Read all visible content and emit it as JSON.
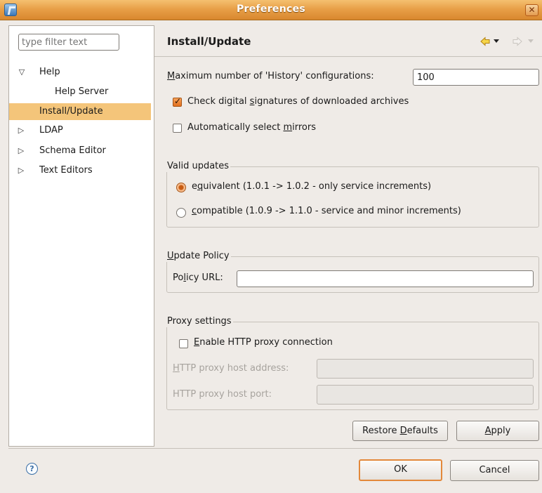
{
  "window": {
    "title": "Preferences",
    "close_glyph": "✕"
  },
  "sidebar": {
    "filter_placeholder": "type filter text",
    "items": [
      {
        "label": "Help",
        "expanded": true
      },
      {
        "label": "Help Server"
      },
      {
        "label": "Install/Update",
        "selected": true
      },
      {
        "label": "LDAP",
        "expanded": false
      },
      {
        "label": "Schema Editor",
        "expanded": false
      },
      {
        "label": "Text Editors",
        "expanded": false
      }
    ]
  },
  "page": {
    "title": "Install/Update",
    "max_history": {
      "label_pre": "M",
      "label_post": "aximum number of 'History' configurations:",
      "value": "100"
    },
    "check_signatures": {
      "pre": "Check digital ",
      "mn": "s",
      "post": "ignatures of downloaded archives",
      "checked": true
    },
    "auto_mirrors": {
      "pre": "Automatically select ",
      "mn": "m",
      "post": "irrors",
      "checked": false
    },
    "valid_updates": {
      "title": "Valid updates",
      "equivalent": {
        "pre": "e",
        "mn": "q",
        "post": "uivalent (1.0.1 -> 1.0.2 - only service increments)",
        "selected": true
      },
      "compatible": {
        "pre": "",
        "mn": "c",
        "post": "ompatible (1.0.9 -> 1.1.0 - service and minor increments)",
        "selected": false
      }
    },
    "update_policy": {
      "title_mn": "U",
      "title_post": "pdate Policy",
      "url_pre": "Po",
      "url_mn": "l",
      "url_post": "icy URL:",
      "url_value": ""
    },
    "proxy": {
      "title": "Proxy settings",
      "enable": {
        "pre": "",
        "mn": "E",
        "post": "nable HTTP proxy connection",
        "checked": false
      },
      "host": {
        "mn": "H",
        "post": "TTP proxy host address:",
        "value": ""
      },
      "port": {
        "label": "HTTP proxy host port:",
        "value": ""
      }
    },
    "restore": {
      "pre": "Restore ",
      "mn": "D",
      "post": "efaults"
    },
    "apply": {
      "mn": "A",
      "post": "pply"
    }
  },
  "footer": {
    "ok_label": "OK",
    "cancel_label": "Cancel",
    "help_glyph": "?"
  },
  "colors": {
    "titlebar": "#e8a048",
    "selection": "#f4c57a",
    "accent": "#e2701e"
  },
  "icons": [
    "app-icon",
    "close-icon",
    "back-arrow-icon",
    "forward-arrow-icon",
    "help-icon"
  ]
}
